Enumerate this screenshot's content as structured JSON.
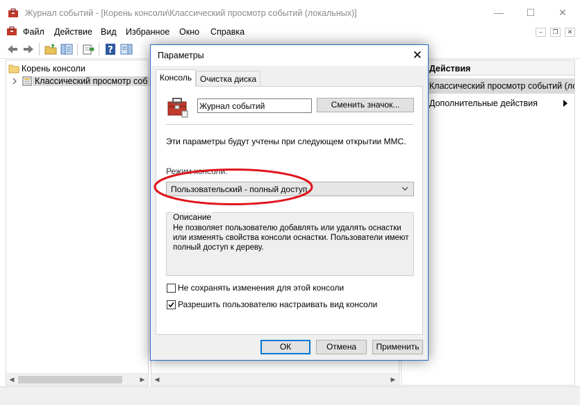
{
  "window": {
    "title": "Журнал событий - [Корень консоли\\Классический просмотр событий (локальных)]",
    "controls": {
      "minimize": "—",
      "maximize": "☐",
      "close": "✕"
    }
  },
  "menubar": {
    "items": [
      "Файл",
      "Действие",
      "Вид",
      "Избранное",
      "Окно",
      "Справка"
    ],
    "inner_controls": {
      "minimize": "–",
      "restore": "❐",
      "close": "✕"
    }
  },
  "toolbar": {
    "buttons": [
      "back-icon",
      "forward-icon",
      "up-folder-icon",
      "show-hide-tree-icon",
      "export-icon",
      "help-icon",
      "show-hide-action-pane-icon"
    ]
  },
  "tree": {
    "root": "Корень консоли",
    "child": "Классический просмотр соб"
  },
  "actions": {
    "header": "Действия",
    "selected": "Классический просмотр событий (ло...",
    "more": "Дополнительные действия"
  },
  "dialog": {
    "title": "Параметры",
    "tabs": [
      "Консоль",
      "Очистка диска"
    ],
    "console_name": "Журнал событий",
    "change_icon_btn": "Сменить значок...",
    "info_text": "Эти параметры будут учтены при следующем открытии MMC.",
    "mode_label": "Режим консоли:",
    "mode_value": "Пользовательский - полный доступ",
    "description_legend": "Описание",
    "description_text": "Не позволяет пользователю добавлять или удалять оснастки или изменять свойства консоли оснастки. Пользователи имеют полный доступ к дереву.",
    "checkbox1_label": "Не сохранять изменения для этой консоли",
    "checkbox1_checked": false,
    "checkbox2_label": "Разрешить пользователю настраивать вид консоли",
    "checkbox2_checked": true,
    "ok": "ОК",
    "cancel": "Отмена",
    "apply": "Применить"
  },
  "colors": {
    "accent": "#0078d7",
    "highlight_ellipse": "#e0141b",
    "selected_bg": "#d9d9d9"
  }
}
